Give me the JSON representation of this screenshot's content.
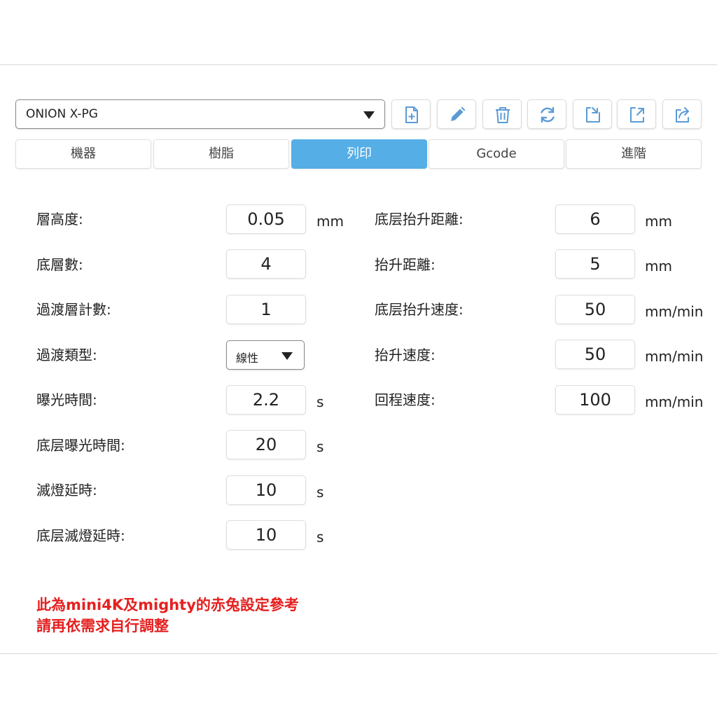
{
  "profile": {
    "selected": "ONION X-PG"
  },
  "toolbar": {
    "icons": [
      "add-file-icon",
      "pencil-icon",
      "trash-icon",
      "refresh-icon",
      "import-icon",
      "export-icon",
      "share-icon"
    ],
    "icon_color": "#5b9bd5"
  },
  "tabs": [
    {
      "label": "機器",
      "active": false
    },
    {
      "label": "樹脂",
      "active": false
    },
    {
      "label": "列印",
      "active": true
    },
    {
      "label": "Gcode",
      "active": false
    },
    {
      "label": "進階",
      "active": false
    }
  ],
  "left_fields": [
    {
      "label": "層高度:",
      "value": "0.05",
      "unit": "mm"
    },
    {
      "label": "底層數:",
      "value": "4",
      "unit": ""
    },
    {
      "label": "過渡層計數:",
      "value": "1",
      "unit": ""
    },
    {
      "label": "過渡類型:",
      "value": "線性",
      "unit": ""
    },
    {
      "label": "曝光時間:",
      "value": "2.2",
      "unit": "s"
    },
    {
      "label": "底层曝光時間:",
      "value": "20",
      "unit": "s"
    },
    {
      "label": "滅燈延時:",
      "value": "10",
      "unit": "s"
    },
    {
      "label": "底层滅燈延時:",
      "value": "10",
      "unit": "s"
    }
  ],
  "right_fields": [
    {
      "label": "底层抬升距離:",
      "value": "6",
      "unit": "mm"
    },
    {
      "label": "抬升距離:",
      "value": "5",
      "unit": "mm"
    },
    {
      "label": "底层抬升速度:",
      "value": "50",
      "unit": "mm/min"
    },
    {
      "label": "抬升速度:",
      "value": "50",
      "unit": "mm/min"
    },
    {
      "label": "回程速度:",
      "value": "100",
      "unit": "mm/min"
    }
  ],
  "note": {
    "line1": "此為mini4K及mighty的赤兔設定參考",
    "line2": "請再依需求自行調整",
    "color": "#e52020"
  },
  "colors": {
    "active_tab": "#55aee6"
  }
}
